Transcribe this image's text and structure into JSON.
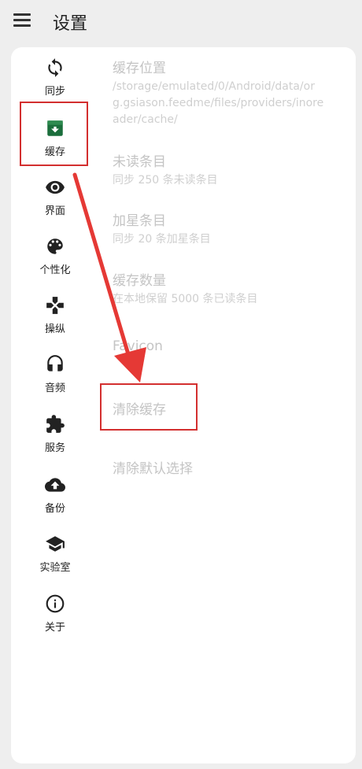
{
  "header": {
    "title": "设置"
  },
  "nav": {
    "items": [
      {
        "label": "同步",
        "icon": "sync-icon"
      },
      {
        "label": "缓存",
        "icon": "archive-icon"
      },
      {
        "label": "界面",
        "icon": "eye-icon"
      },
      {
        "label": "个性化",
        "icon": "palette-icon"
      },
      {
        "label": "操纵",
        "icon": "gamepad-icon"
      },
      {
        "label": "音频",
        "icon": "headphones-icon"
      },
      {
        "label": "服务",
        "icon": "puzzle-icon"
      },
      {
        "label": "备份",
        "icon": "cloud-upload-icon"
      },
      {
        "label": "实验室",
        "icon": "school-icon"
      },
      {
        "label": "关于",
        "icon": "info-icon"
      }
    ]
  },
  "settings": {
    "cache_location": {
      "title": "缓存位置",
      "subtitle": "/storage/emulated/0/Android/data/org.gsiason.feedme/files/providers/inoreader/cache/"
    },
    "unread": {
      "title": "未读条目",
      "subtitle": "同步 250 条未读条目"
    },
    "starred": {
      "title": "加星条目",
      "subtitle": "同步 20 条加星条目"
    },
    "cache_count": {
      "title": "缓存数量",
      "subtitle": "在本地保留 5000 条已读条目"
    },
    "favicon": {
      "title": "Favicon"
    },
    "clear_cache": {
      "title": "清除缓存"
    },
    "clear_defaults": {
      "title": "清除默认选择"
    }
  },
  "colors": {
    "accent_green": "#1b6e3c",
    "annotation_red": "#e53935",
    "muted_text": "#c4c4c4"
  }
}
